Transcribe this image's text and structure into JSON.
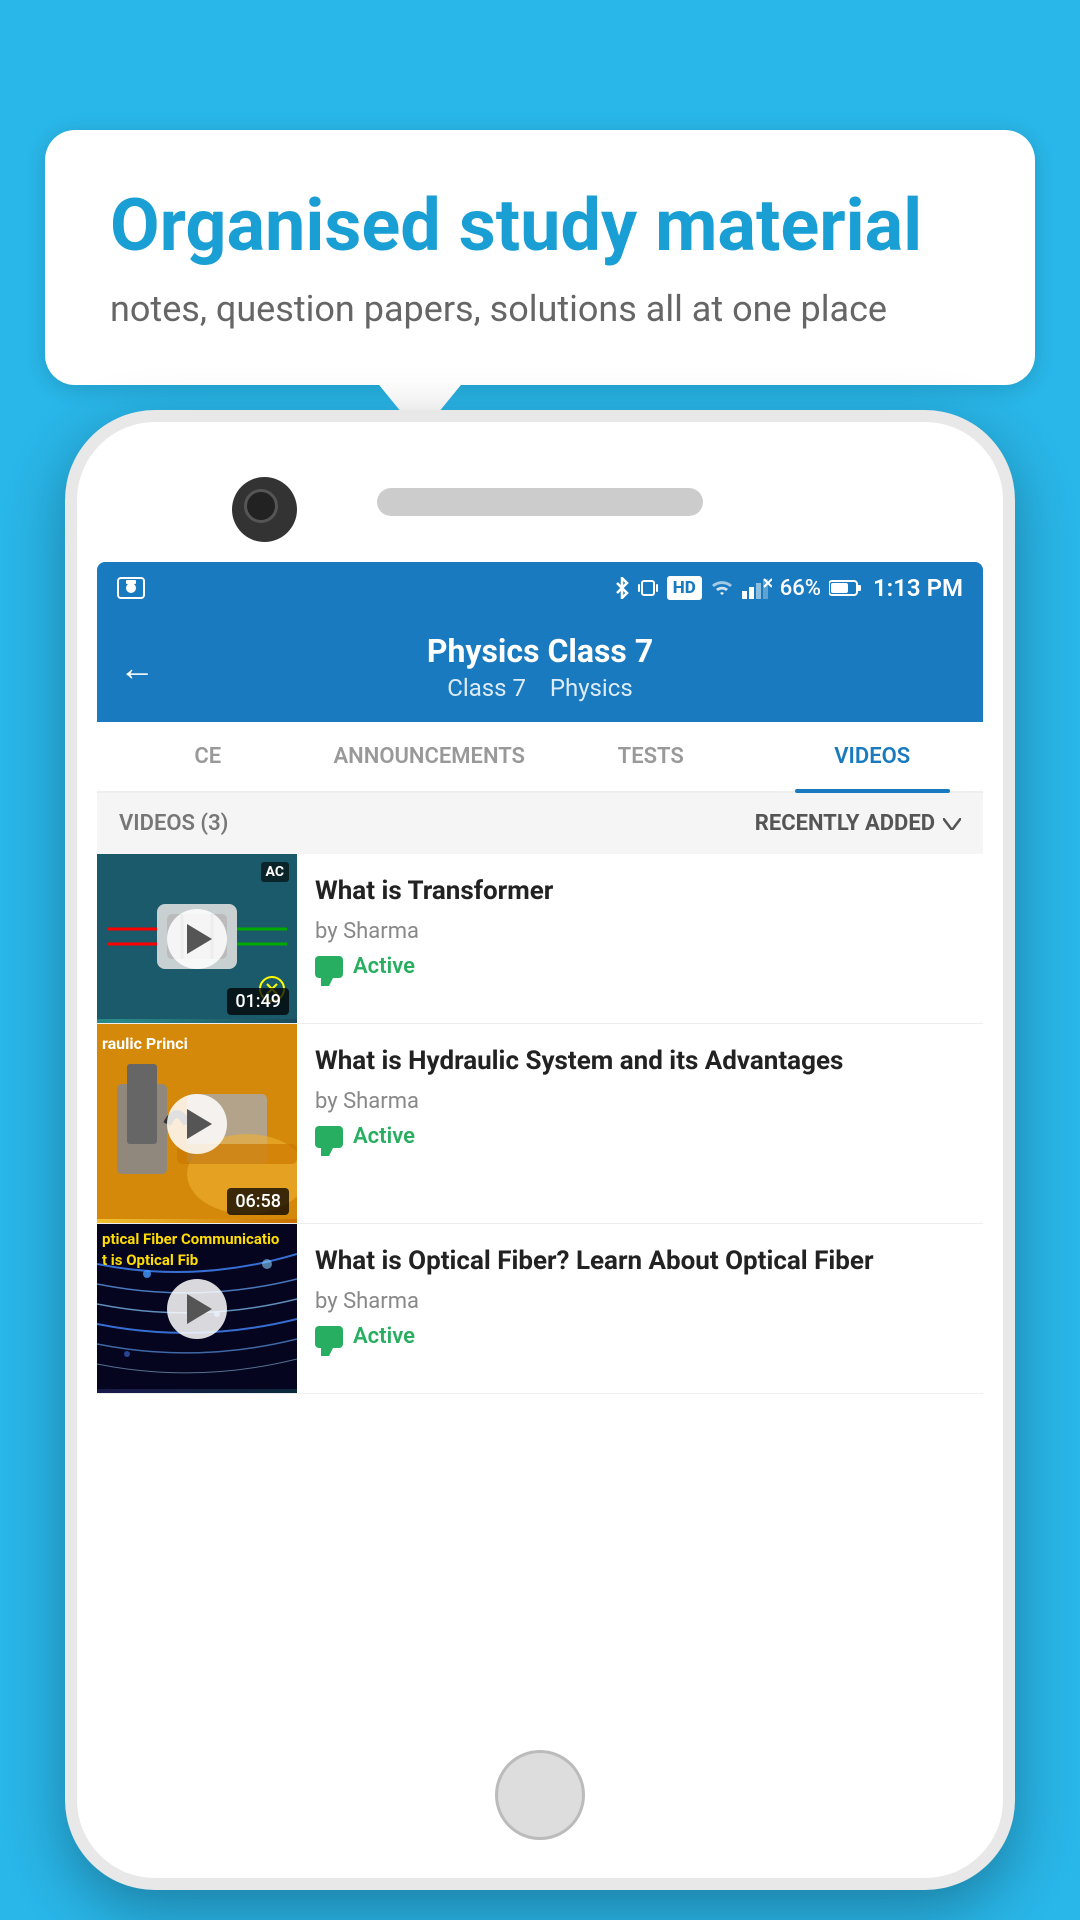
{
  "background_color": "#29b6e8",
  "speech_bubble": {
    "title": "Organised study material",
    "subtitle": "notes, question papers, solutions all at one place"
  },
  "phone": {
    "status_bar": {
      "battery_percent": "66%",
      "time": "1:13 PM",
      "hd_label": "HD"
    },
    "header": {
      "back_arrow": "←",
      "title": "Physics Class 7",
      "subtitle_class": "Class 7",
      "subtitle_subject": "Physics"
    },
    "tabs": [
      {
        "label": "CE",
        "active": false
      },
      {
        "label": "ANNOUNCEMENTS",
        "active": false
      },
      {
        "label": "TESTS",
        "active": false
      },
      {
        "label": "VIDEOS",
        "active": true
      }
    ],
    "videos_section": {
      "count_label": "VIDEOS (3)",
      "sort_label": "RECENTLY ADDED"
    },
    "videos": [
      {
        "title": "What is  Transformer",
        "author": "by Sharma",
        "status": "Active",
        "duration": "01:49",
        "thumbnail_type": "transformer"
      },
      {
        "title": "What is Hydraulic System and its Advantages",
        "author": "by Sharma",
        "status": "Active",
        "duration": "06:58",
        "thumbnail_type": "hydraulic"
      },
      {
        "title": "What is Optical Fiber? Learn About Optical Fiber",
        "author": "by Sharma",
        "status": "Active",
        "duration": "",
        "thumbnail_type": "optical"
      }
    ]
  }
}
